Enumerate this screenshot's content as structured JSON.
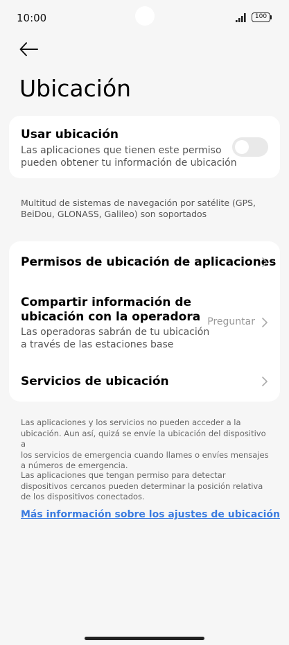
{
  "status_bar": {
    "time": "10:00",
    "battery": "100",
    "signal_icon": "signal-bars-icon",
    "battery_icon": "battery-icon"
  },
  "header": {
    "back_icon": "arrow-left-icon",
    "title": "Ubicación"
  },
  "location_card": {
    "title": "Usar ubicación",
    "subtitle_line1": "Las aplicaciones que tienen este permiso",
    "subtitle_line2": "pueden obtener tu información de ubicación",
    "toggle_on": false
  },
  "gnss_note": {
    "line1": "Multitud de sistemas de navegación por satélite (GPS,",
    "line2": "BeiDou, GLONASS, Galileo) son soportados"
  },
  "list": {
    "app_permissions": {
      "title": "Permisos de ubicación de aplicaciones"
    },
    "carrier": {
      "title_line1": "Compartir información de",
      "title_line2": "ubicación con la operadora",
      "subtitle_line1": "Las operadoras sabrán de tu ubicación",
      "subtitle_line2": "a través de las estaciones base",
      "value": "Preguntar"
    },
    "services": {
      "title": "Servicios de ubicación"
    }
  },
  "footer": {
    "para1_line1": "Las aplicaciones y los servicios no pueden acceder a la",
    "para1_line2": "ubicación. Aun así, quizá se envíe la ubicación del dispositivo a",
    "para1_line3": "los servicios de emergencia cuando llames o envíes mensajes",
    "para1_line4": "a números de emergencia.",
    "para2_line1": "Las aplicaciones que tengan permiso para detectar",
    "para2_line2": "dispositivos cercanos pueden determinar la posición relativa",
    "para2_line3": "de los dispositivos conectados.",
    "link": "Más información sobre los ajustes de ubicación"
  },
  "colors": {
    "background": "#f6f6f6",
    "card": "#ffffff",
    "link": "#3b7ce0",
    "toggle_off": "#e9e9e9"
  }
}
